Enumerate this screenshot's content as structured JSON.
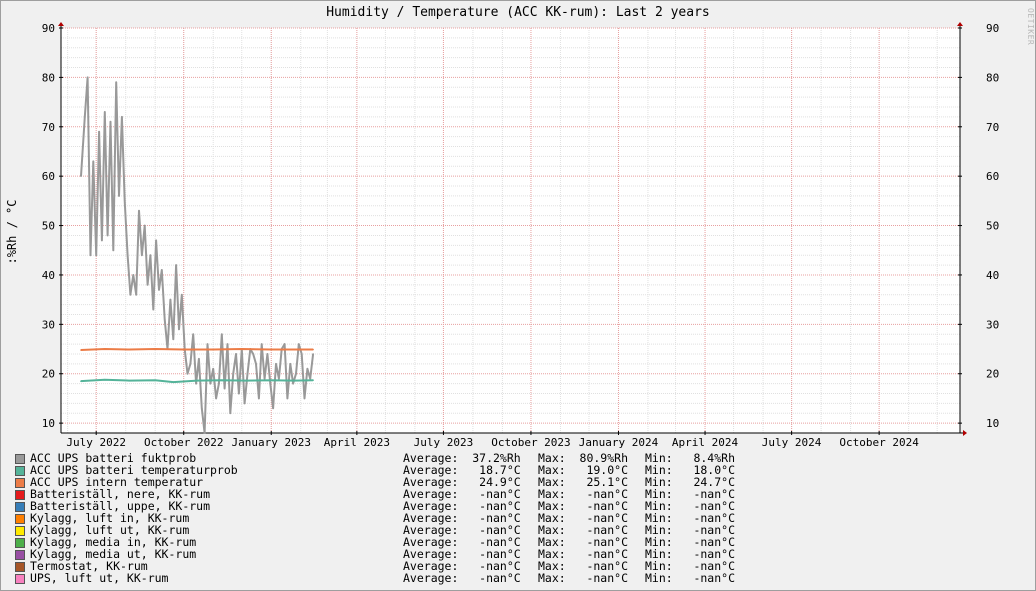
{
  "chart_data": {
    "type": "line",
    "title": "Humidity / Temperature (ACC KK-rum): Last 2 years",
    "ylabel": ":%Rh / °C",
    "watermark": "RRDTOOL / TOBI OETIKER",
    "ylim": [
      8,
      90
    ],
    "y_ticks": [
      10,
      20,
      30,
      40,
      50,
      60,
      70,
      80,
      90
    ],
    "x_range": [
      "2022-05-25",
      "2024-12-25"
    ],
    "x_ticks": [
      {
        "date": "2022-07-01",
        "label": "July 2022"
      },
      {
        "date": "2022-10-01",
        "label": "October 2022"
      },
      {
        "date": "2023-01-01",
        "label": "January 2023"
      },
      {
        "date": "2023-04-01",
        "label": "April 2023"
      },
      {
        "date": "2023-07-01",
        "label": "July 2023"
      },
      {
        "date": "2023-10-01",
        "label": "October 2023"
      },
      {
        "date": "2024-01-01",
        "label": "January 2024"
      },
      {
        "date": "2024-04-01",
        "label": "April 2024"
      },
      {
        "date": "2024-07-01",
        "label": "July 2024"
      },
      {
        "date": "2024-10-01",
        "label": "October 2024"
      }
    ],
    "grid": true,
    "series": [
      {
        "name": "ACC UPS batteri fuktprob",
        "color": "#999999",
        "avg": "37.2%Rh",
        "max": "80.9%Rh",
        "min": "8.4%Rh",
        "x": [
          "2022-06-15",
          "2022-06-19",
          "2022-06-22",
          "2022-06-25",
          "2022-06-28",
          "2022-07-01",
          "2022-07-04",
          "2022-07-07",
          "2022-07-10",
          "2022-07-13",
          "2022-07-16",
          "2022-07-19",
          "2022-07-22",
          "2022-07-25",
          "2022-07-28",
          "2022-07-31",
          "2022-08-03",
          "2022-08-06",
          "2022-08-09",
          "2022-08-12",
          "2022-08-15",
          "2022-08-18",
          "2022-08-21",
          "2022-08-24",
          "2022-08-27",
          "2022-08-30",
          "2022-09-02",
          "2022-09-05",
          "2022-09-08",
          "2022-09-11",
          "2022-09-14",
          "2022-09-17",
          "2022-09-20",
          "2022-09-23",
          "2022-09-26",
          "2022-09-29",
          "2022-10-02",
          "2022-10-05",
          "2022-10-08",
          "2022-10-11",
          "2022-10-14",
          "2022-10-17",
          "2022-10-20",
          "2022-10-23",
          "2022-10-26",
          "2022-10-29",
          "2022-11-01",
          "2022-11-04",
          "2022-11-07",
          "2022-11-10",
          "2022-11-13",
          "2022-11-16",
          "2022-11-19",
          "2022-11-22",
          "2022-11-25",
          "2022-11-28",
          "2022-12-01",
          "2022-12-04",
          "2022-12-07",
          "2022-12-10",
          "2022-12-13",
          "2022-12-16",
          "2022-12-19",
          "2022-12-22",
          "2022-12-25",
          "2022-12-28",
          "2022-12-31",
          "2023-01-03",
          "2023-01-06",
          "2023-01-09",
          "2023-01-12",
          "2023-01-15",
          "2023-01-18",
          "2023-01-21",
          "2023-01-24",
          "2023-01-27",
          "2023-01-30",
          "2023-02-02",
          "2023-02-05",
          "2023-02-08",
          "2023-02-11",
          "2023-02-14"
        ],
        "values": [
          60,
          72,
          80,
          44,
          63,
          44,
          69,
          47,
          73,
          48,
          71,
          45,
          79,
          56,
          72,
          55,
          44,
          36,
          40,
          36,
          53,
          44,
          50,
          38,
          44,
          33,
          47,
          37,
          41,
          31,
          25,
          35,
          27,
          42,
          29,
          36,
          25,
          20,
          22,
          28,
          18,
          23,
          13,
          8,
          26,
          18,
          21,
          15,
          18,
          28,
          17,
          26,
          12,
          20,
          24,
          16,
          25,
          14,
          20,
          25,
          24,
          22,
          15,
          26,
          19,
          24,
          18,
          13,
          22,
          19,
          25,
          26,
          15,
          22,
          18,
          20,
          26,
          24,
          15,
          21,
          19,
          24
        ]
      },
      {
        "name": "ACC UPS batteri temperaturprob",
        "color": "#54b399",
        "avg": "18.7°C",
        "max": "19.0°C",
        "min": "18.0°C",
        "x": [
          "2022-06-15",
          "2022-07-10",
          "2022-08-05",
          "2022-09-01",
          "2022-09-20",
          "2022-10-15",
          "2022-11-10",
          "2022-12-05",
          "2023-01-01",
          "2023-01-25",
          "2023-02-14"
        ],
        "values": [
          18.5,
          18.8,
          18.6,
          18.7,
          18.3,
          18.6,
          18.7,
          18.6,
          18.7,
          18.6,
          18.7
        ]
      },
      {
        "name": "ACC UPS intern temperatur",
        "color": "#ec7c47",
        "avg": "24.9°C",
        "max": "25.1°C",
        "min": "24.7°C",
        "x": [
          "2022-06-15",
          "2022-07-10",
          "2022-08-05",
          "2022-09-01",
          "2022-10-01",
          "2022-11-01",
          "2022-12-01",
          "2023-01-01",
          "2023-02-14"
        ],
        "values": [
          24.8,
          25.0,
          24.9,
          25.0,
          24.9,
          24.9,
          25.0,
          24.9,
          24.9
        ]
      },
      {
        "name": "Batteriställ, nere, KK-rum",
        "color": "#e41a1c",
        "avg": "-nan°C",
        "max": "-nan°C",
        "min": "-nan°C",
        "x": [],
        "values": []
      },
      {
        "name": "Batteriställ, uppe, KK-rum",
        "color": "#377eb8",
        "avg": "-nan°C",
        "max": "-nan°C",
        "min": "-nan°C",
        "x": [],
        "values": []
      },
      {
        "name": "Kylagg, luft in, KK-rum",
        "color": "#ff7f00",
        "avg": "-nan°C",
        "max": "-nan°C",
        "min": "-nan°C",
        "x": [],
        "values": []
      },
      {
        "name": "Kylagg, luft ut, KK-rum",
        "color": "#ffea00",
        "avg": "-nan°C",
        "max": "-nan°C",
        "min": "-nan°C",
        "x": [],
        "values": []
      },
      {
        "name": "Kylagg, media in, KK-rum",
        "color": "#4daf4a",
        "avg": "-nan°C",
        "max": "-nan°C",
        "min": "-nan°C",
        "x": [],
        "values": []
      },
      {
        "name": "Kylagg, media ut, KK-rum",
        "color": "#984ea3",
        "avg": "-nan°C",
        "max": "-nan°C",
        "min": "-nan°C",
        "x": [],
        "values": []
      },
      {
        "name": "Termostat, KK-rum",
        "color": "#a65628",
        "avg": "-nan°C",
        "max": "-nan°C",
        "min": "-nan°C",
        "x": [],
        "values": []
      },
      {
        "name": "UPS, luft ut, KK-rum",
        "color": "#f781bf",
        "avg": "-nan°C",
        "max": "-nan°C",
        "min": "-nan°C",
        "x": [],
        "values": []
      }
    ],
    "legend": {
      "placement": "bottom",
      "avg_label": "Average:",
      "max_label": "Max:",
      "min_label": "Min:"
    }
  }
}
